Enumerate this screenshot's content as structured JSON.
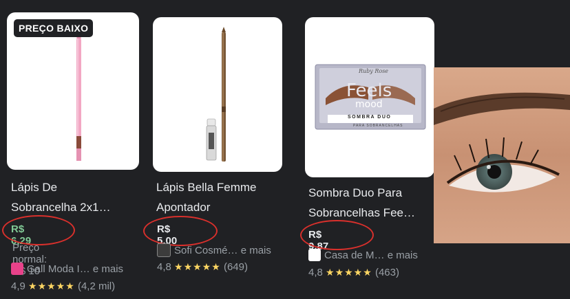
{
  "products": [
    {
      "badge": "PREÇO BAIXO",
      "title_line1": "Lápis De",
      "title_line2": "Sobrancelha 2x1…",
      "price": "R$ 6,29",
      "normal_price": "Preço normal: R$ 10",
      "seller": "Gall Moda I…  e mais",
      "rating": "4,9",
      "stars": "★★★★★",
      "reviews": "(4,2 mil)",
      "image": "pink-eyebrow-pencil"
    },
    {
      "title_line1": "Lápis Bella Femme",
      "title_line2": "Apontador",
      "price": "R$ 5,00",
      "seller": "Sofi Cosmé…  e mais",
      "rating": "4,8",
      "stars": "★★★★★",
      "reviews": "(649)",
      "image": "brown-pencil-with-sharpener"
    },
    {
      "title_line1": "Sombra Duo Para",
      "title_line2": "Sobrancelhas Fee…",
      "price": "R$ 9,87",
      "seller": "Casa de M…  e mais",
      "rating": "4,8",
      "stars": "★★★★★",
      "reviews": "(463)",
      "image": "eyebrow-shadow-palette",
      "palette_brand": "Ruby Rose",
      "palette_name_1": "Feels",
      "palette_name_2": "mood",
      "palette_label": "SOMBRA DUO",
      "palette_sublabel": "PARA SOBRANCELHAS"
    }
  ],
  "side_image": "eye-closeup-photo",
  "colors": {
    "sale_price": "#81c995",
    "highlight_circle": "#d9302c",
    "stars": "#fdd663"
  }
}
